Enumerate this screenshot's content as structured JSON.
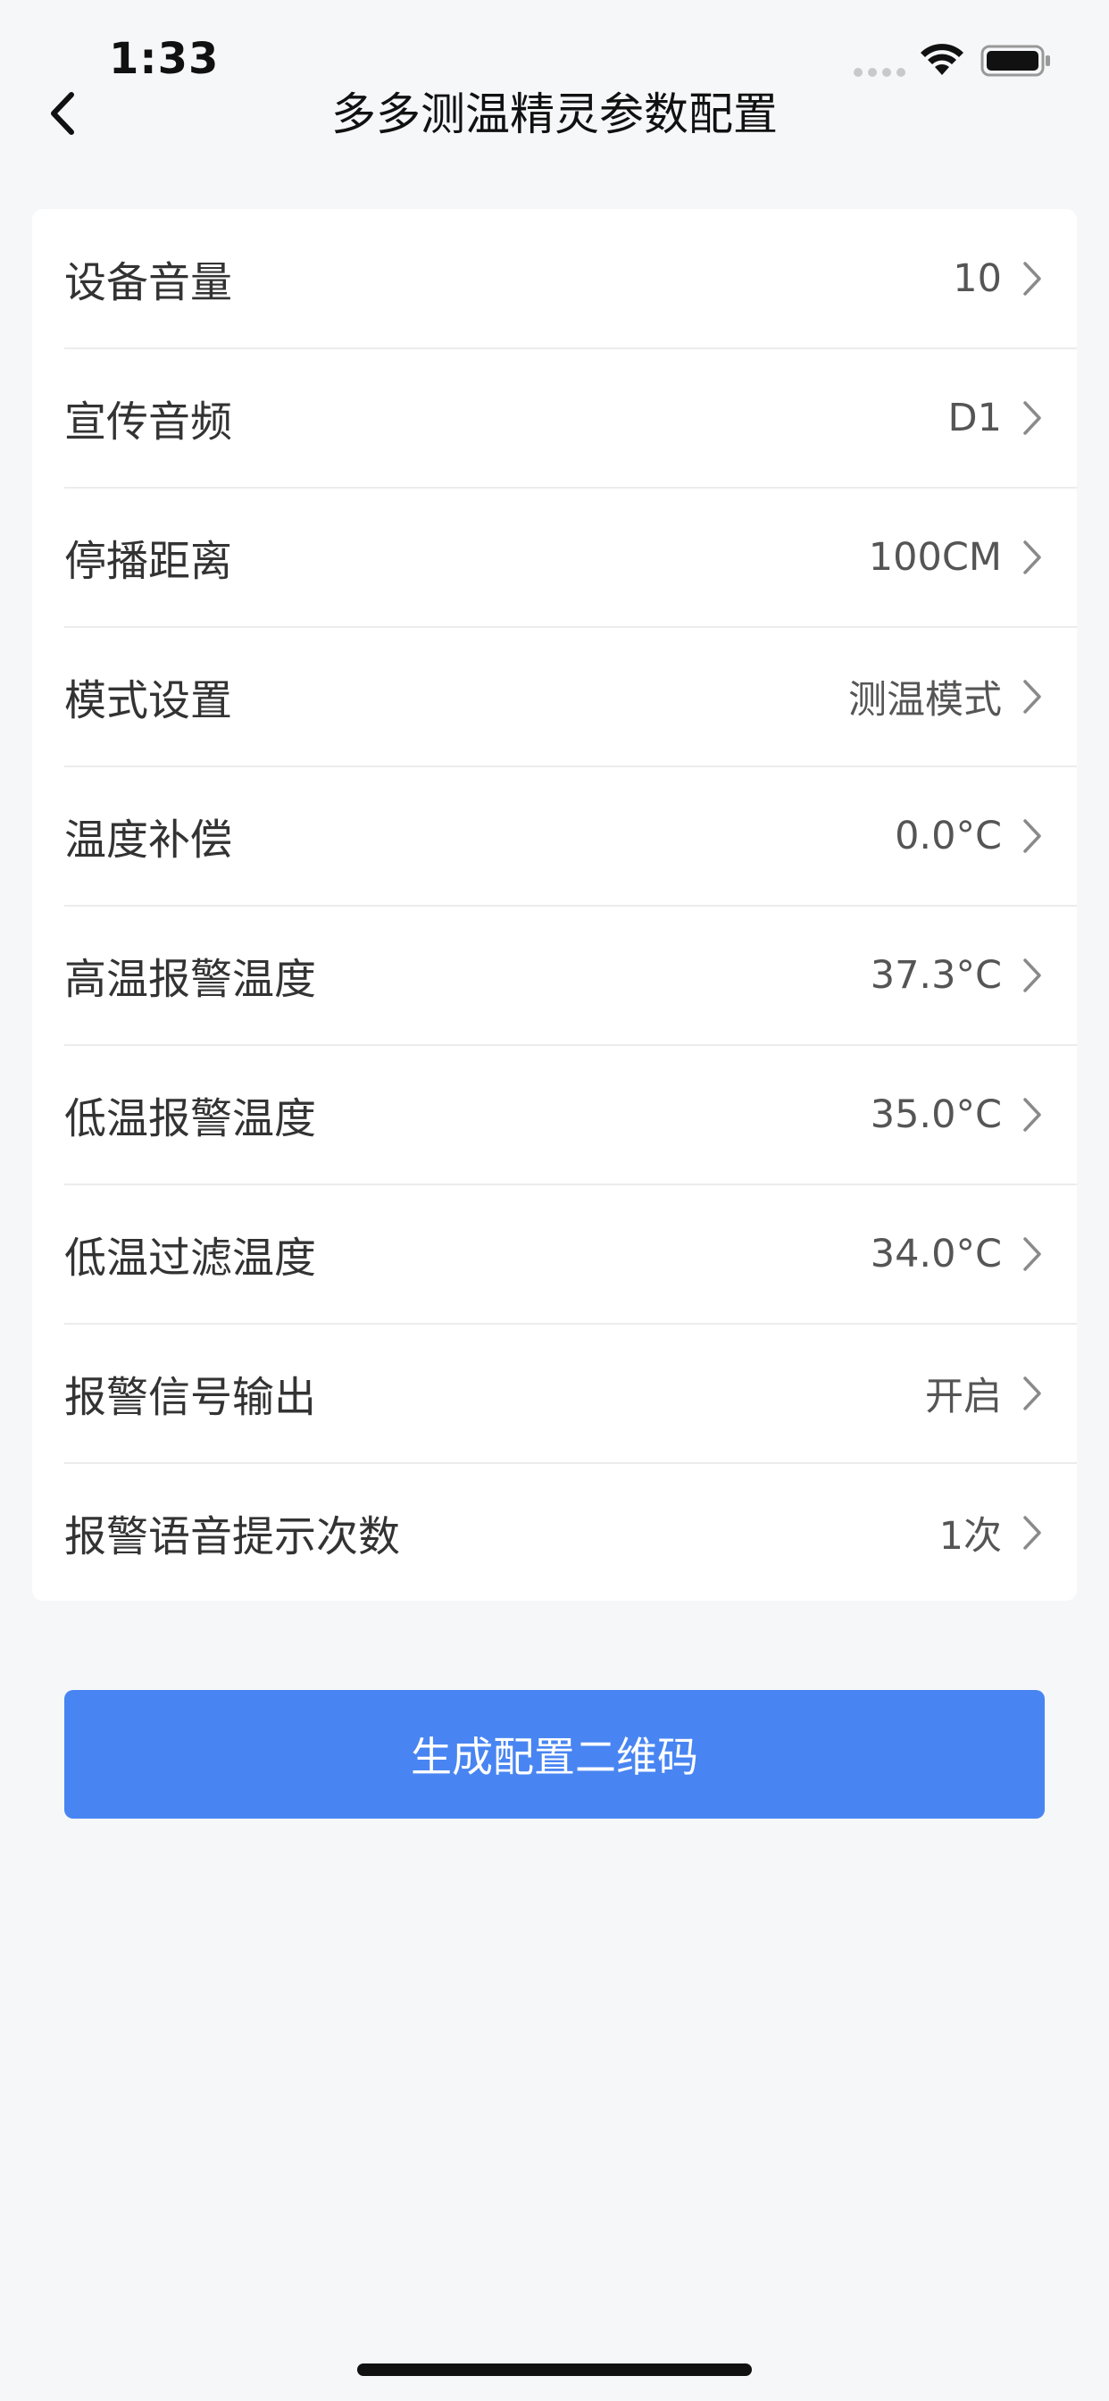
{
  "status_bar": {
    "time": "1:33",
    "icons": [
      "signal-dots-icon",
      "wifi-icon",
      "battery-icon"
    ]
  },
  "nav": {
    "back_icon": "chevron-left-icon",
    "title": "多多测温精灵参数配置"
  },
  "settings": {
    "items": [
      {
        "label": "设备音量",
        "value": "10"
      },
      {
        "label": "宣传音频",
        "value": "D1"
      },
      {
        "label": "停播距离",
        "value": "100CM"
      },
      {
        "label": "模式设置",
        "value": "测温模式"
      },
      {
        "label": "温度补偿",
        "value": "0.0°C"
      },
      {
        "label": "高温报警温度",
        "value": "37.3°C"
      },
      {
        "label": "低温报警温度",
        "value": "35.0°C"
      },
      {
        "label": "低温过滤温度",
        "value": "34.0°C"
      },
      {
        "label": "报警信号输出",
        "value": "开启"
      },
      {
        "label": "报警语音提示次数",
        "value": "1次"
      }
    ]
  },
  "actions": {
    "generate_label": "生成配置二维码"
  },
  "colors": {
    "accent": "#4885f2",
    "background": "#f6f7f9",
    "card": "#ffffff"
  }
}
